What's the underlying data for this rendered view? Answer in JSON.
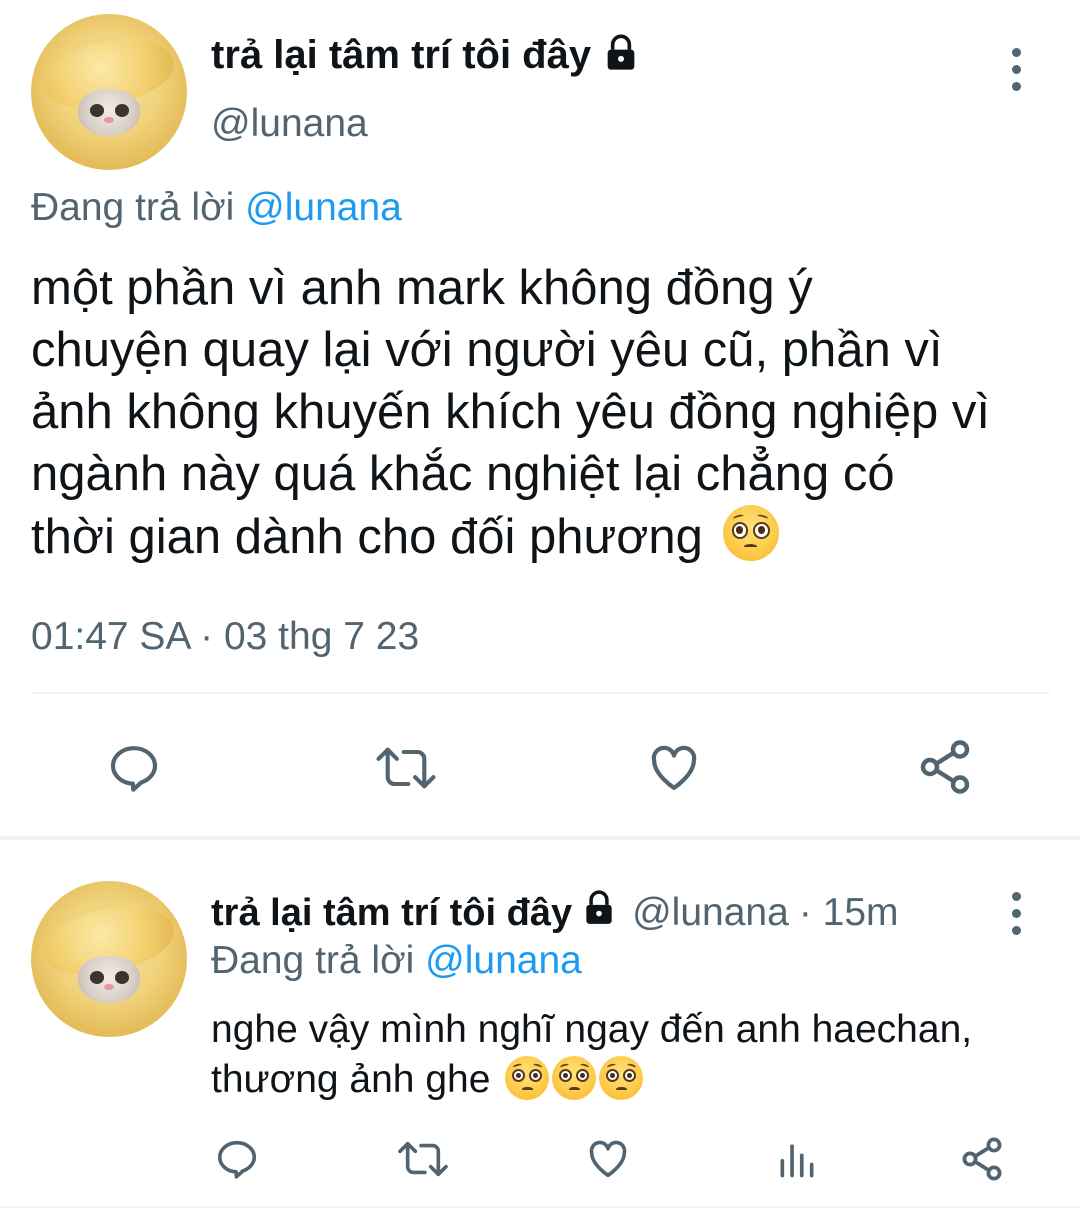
{
  "main_tweet": {
    "display_name": "trả lại tâm trí tôi đây",
    "handle": "@lunana",
    "replying_prefix": "Đang trả lời",
    "replying_to": "@lunana",
    "text": "một phần vì anh mark không đồng ý chuyện quay lại với người yêu cũ, phần vì ảnh không khuyến khích yêu đồng nghiệp vì ngành này quá khắc nghiệt lại chẳng có thời gian dành cho đối phương",
    "text_lines": [
      "một phần vì anh mark không đồng ý",
      "chuyện quay lại với người yêu cũ, phần vì",
      "ảnh không khuyến khích yêu đồng nghiệp vì",
      "ngành này quá khắc nghiệt lại chẳng có",
      "thời gian dành cho đối phương"
    ],
    "emoji": "pleading-face",
    "timestamp": "01:47 SA · 03 thg 7 23",
    "actions": [
      "reply-icon",
      "retweet-icon",
      "like-icon",
      "share-icon"
    ]
  },
  "reply_tweet": {
    "display_name": "trả lại tâm trí tôi đây",
    "handle": "@lunana",
    "time_ago": "· 15m",
    "replying_prefix": "Đang trả lời",
    "replying_to": "@lunana",
    "text_lines": [
      "nghe vậy mình nghĩ ngay đến anh haechan,",
      "thương ảnh ghe"
    ],
    "emojis": [
      "pleading-face",
      "pleading-face",
      "pleading-face"
    ],
    "actions": [
      "reply-icon",
      "retweet-icon",
      "like-icon",
      "views-icon",
      "share-icon"
    ]
  },
  "colors": {
    "text": "#0f1419",
    "muted": "#536471",
    "link": "#1d9bf0",
    "divider": "#eff3f4"
  }
}
